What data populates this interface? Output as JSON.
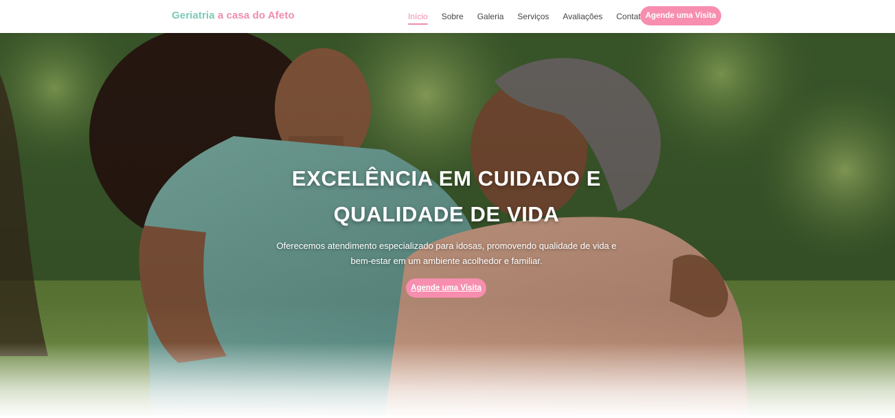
{
  "header": {
    "brand_part1": "Geriatria",
    "brand_part2": "a casa do Afeto",
    "nav": [
      {
        "label": "Início",
        "active": true
      },
      {
        "label": "Sobre",
        "active": false
      },
      {
        "label": "Galeria",
        "active": false
      },
      {
        "label": "Serviços",
        "active": false
      },
      {
        "label": "Avaliações",
        "active": false
      },
      {
        "label": "Contato",
        "active": false
      }
    ],
    "cta_label": "Agende uma Visita"
  },
  "hero": {
    "title_line1": "EXCELÊNCIA EM CUIDADO E",
    "title_line2": "QUALIDADE DE VIDA",
    "subtitle_line1": "Oferecemos atendimento especializado para idosas, promovendo qualidade de vida e",
    "subtitle_line2": "bem-estar em um ambiente acolhedor e familiar.",
    "cta_label": "Agende uma Visita",
    "image_icon": "caregiver-and-elderly-woman-photo"
  },
  "colors": {
    "brand_green": "#7ec9b6",
    "brand_pink": "#f08cae",
    "button_pink": "#f78eb0",
    "nav_text": "#444444"
  }
}
